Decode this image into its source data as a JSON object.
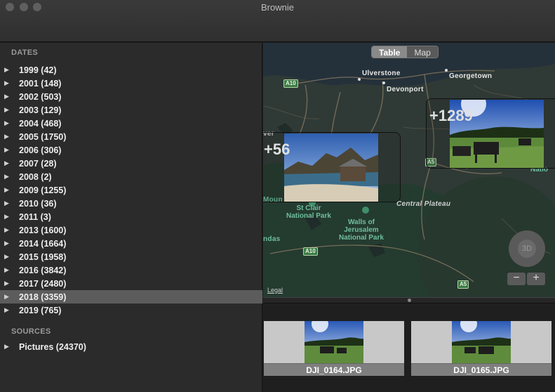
{
  "window": {
    "title": "Brownie"
  },
  "sidebar": {
    "dates_header": "DATES",
    "dates": [
      {
        "label": "1999 (42)"
      },
      {
        "label": "2001 (148)"
      },
      {
        "label": "2002 (503)"
      },
      {
        "label": "2003 (129)"
      },
      {
        "label": "2004 (468)"
      },
      {
        "label": "2005 (1750)"
      },
      {
        "label": "2006 (306)"
      },
      {
        "label": "2007 (28)"
      },
      {
        "label": "2008 (2)"
      },
      {
        "label": "2009 (1255)"
      },
      {
        "label": "2010 (36)"
      },
      {
        "label": "2011 (3)"
      },
      {
        "label": "2013 (1600)"
      },
      {
        "label": "2014 (1664)"
      },
      {
        "label": "2015 (1958)"
      },
      {
        "label": "2016 (3842)"
      },
      {
        "label": "2017 (2480)"
      },
      {
        "label": "2018 (3359)",
        "selected": true
      },
      {
        "label": "2019 (765)"
      }
    ],
    "sources_header": "SOURCES",
    "sources": [
      {
        "label": "Pictures (24370)"
      }
    ]
  },
  "view_toggle": {
    "table": "Table",
    "map": "Map",
    "selected": "Map"
  },
  "map": {
    "places": {
      "ulverstone": "Ulverstone",
      "georgetown": "Georgetown",
      "devonport": "Devonport",
      "central_plateau": "Central Plateau",
      "mount": "Moun",
      "river": "ver",
      "ndas": "ndas"
    },
    "parks": {
      "st_clair": "St Clair\nNational Park",
      "walls": "Walls of\nJerusalem\nNational Park",
      "nation": "Natio"
    },
    "roads": {
      "a10_top": "A10",
      "a5_right": "A5",
      "a10_bottom": "A10",
      "a5_bottom": "A5"
    },
    "clusters": [
      {
        "count": "+56"
      },
      {
        "count": "+1289"
      }
    ],
    "compass_label": "3D",
    "zoom_out": "−",
    "zoom_in": "+",
    "legal": "Legal"
  },
  "thumbnails": [
    {
      "filename": "DJI_0164.JPG"
    },
    {
      "filename": "DJI_0165.JPG"
    }
  ],
  "colors": {
    "sidebar_bg": "#2b2b2b",
    "selection": "#5c5c5c",
    "map_land": "#2f3a36",
    "park_green": "#6fbf9d"
  }
}
